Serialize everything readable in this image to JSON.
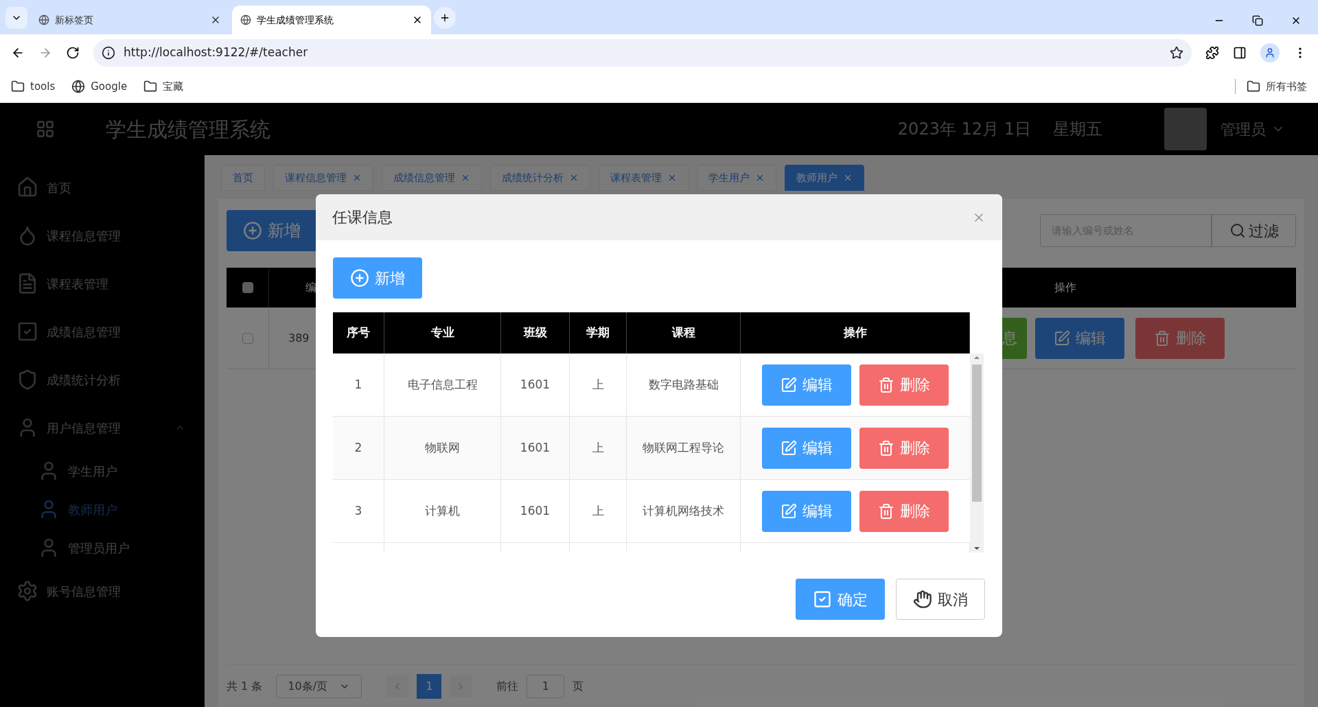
{
  "browser": {
    "tabs": [
      {
        "title": "新标签页",
        "selected": false
      },
      {
        "title": "学生成绩管理系统",
        "selected": true
      }
    ],
    "url": "http://localhost:9122/#/teacher",
    "bookmarks": [
      {
        "kind": "folder",
        "label": "tools"
      },
      {
        "kind": "globe",
        "label": "Google"
      },
      {
        "kind": "folder",
        "label": "宝藏"
      }
    ],
    "all_bookmarks": "所有书签"
  },
  "header": {
    "title": "学生成绩管理系统",
    "date": "2023年 12月 1日",
    "weekday": "星期五",
    "user": "管理员"
  },
  "sidebar": {
    "items": [
      {
        "kind": "home",
        "label": "首页",
        "selected": false
      },
      {
        "kind": "drop",
        "label": "课程信息管理",
        "selected": false
      },
      {
        "kind": "doc",
        "label": "课程表管理",
        "selected": false
      },
      {
        "kind": "check",
        "label": "成绩信息管理",
        "selected": false
      },
      {
        "kind": "shield",
        "label": "成绩统计分析",
        "selected": false
      },
      {
        "kind": "user",
        "label": "用户信息管理",
        "selected": false,
        "expanded": true,
        "children": [
          {
            "kind": "user",
            "label": "学生用户",
            "selected": false
          },
          {
            "kind": "user",
            "label": "教师用户",
            "selected": true
          },
          {
            "kind": "user",
            "label": "管理员用户",
            "selected": false
          }
        ]
      },
      {
        "kind": "gear",
        "label": "账号信息管理",
        "selected": false
      }
    ]
  },
  "page_tabs": [
    {
      "label": "首页",
      "closable": false,
      "selected": false
    },
    {
      "label": "课程信息管理",
      "closable": true,
      "selected": false
    },
    {
      "label": "成绩信息管理",
      "closable": true,
      "selected": false
    },
    {
      "label": "成绩统计分析",
      "closable": true,
      "selected": false
    },
    {
      "label": "课程表管理",
      "closable": true,
      "selected": false
    },
    {
      "label": "学生用户",
      "closable": true,
      "selected": false
    },
    {
      "label": "教师用户",
      "closable": true,
      "selected": true
    }
  ],
  "background": {
    "add_button": "新增",
    "search": {
      "placeholder": "请输入编号或姓名"
    },
    "filter_button": "过滤",
    "column_2": "编",
    "header_checked": false,
    "actions_header": "操作",
    "row": {
      "checked": false,
      "column_2": "389",
      "info_button": "息",
      "edit_button": "编辑",
      "delete_button": "删除"
    }
  },
  "pagination": {
    "total": "共 1 条",
    "page_size": "10条/页",
    "current": "1",
    "goto_label": "前往",
    "goto_value": "1",
    "page_unit": "页"
  },
  "dialog": {
    "title": "任课信息",
    "add_button": "新增",
    "columns": [
      "序号",
      "专业",
      "班级",
      "学期",
      "课程",
      "操作"
    ],
    "rows": [
      {
        "cells": [
          "1",
          "电子信息工程",
          "1601",
          "上",
          "数字电路基础"
        ],
        "edit": "编辑",
        "delete": "删除"
      },
      {
        "cells": [
          "2",
          "物联网",
          "1601",
          "上",
          "物联网工程导论"
        ],
        "edit": "编辑",
        "delete": "删除"
      },
      {
        "cells": [
          "3",
          "计算机",
          "1601",
          "上",
          "计算机网络技术"
        ],
        "edit": "编辑",
        "delete": "删除"
      }
    ],
    "confirm": "确定",
    "cancel": "取消"
  }
}
